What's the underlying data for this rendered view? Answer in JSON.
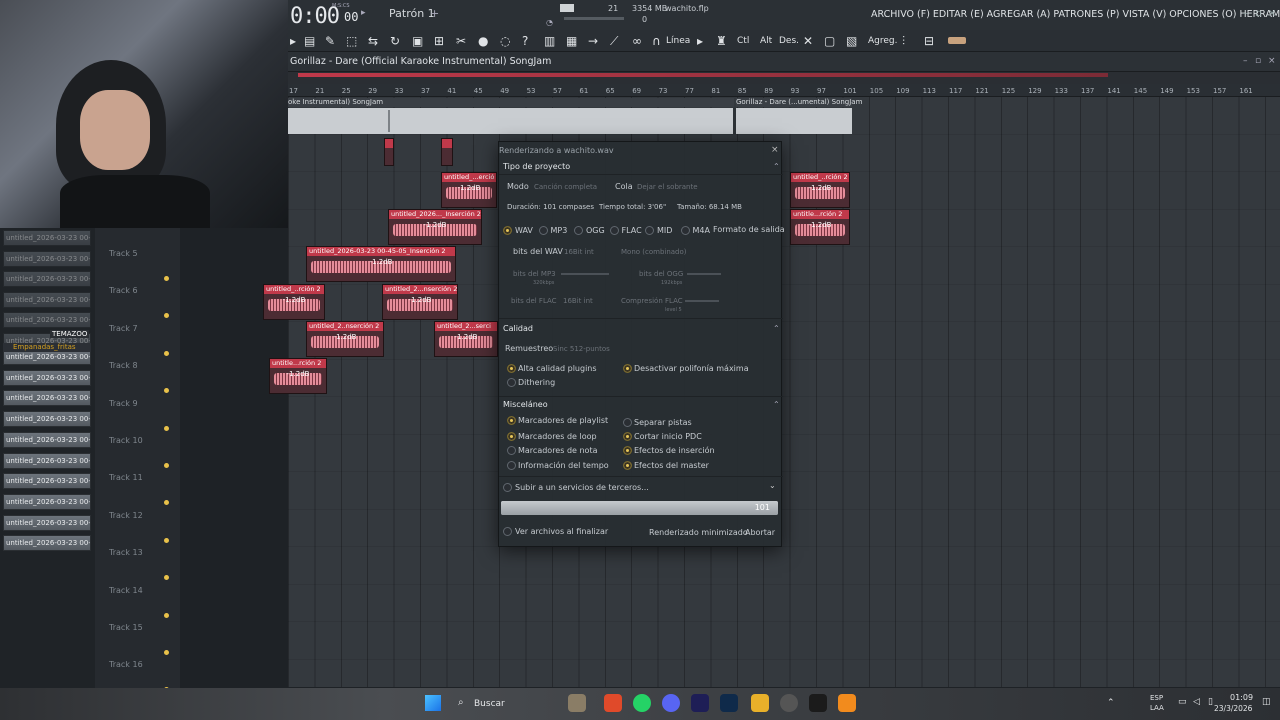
{
  "transport": {
    "time": "0:00",
    "time_sub": "00",
    "mcs": "M:S:CS",
    "pattern": "Patrón 1",
    "cpu": "21",
    "memory": "3354 MB",
    "voices": "0",
    "file": "wachito.flp"
  },
  "menu": "ARCHIVO (F) EDITAR (E) AGREGAR (A) PATRONES (P) VISTA (V) OPCIONES (O) HERRAMIENTAS (T) AYUDA",
  "toolbar": {
    "line": "Línea",
    "ctl": "Ctl",
    "alt": "Alt",
    "des": "Des.",
    "agreg": "Agreg."
  },
  "playlist": {
    "title": "Gorillaz - Dare (Official Karaoke Instrumental) SongJam",
    "ruler": [
      "17",
      "21",
      "25",
      "29",
      "33",
      "37",
      "41",
      "45",
      "49",
      "53",
      "57",
      "61",
      "65",
      "69",
      "73",
      "77",
      "81",
      "85",
      "89",
      "93",
      "97",
      "101",
      "105",
      "109",
      "113",
      "117",
      "121",
      "125",
      "129",
      "133",
      "137",
      "141",
      "145",
      "149",
      "153",
      "157",
      "161"
    ],
    "audio_left": "oke Instrumental) SongJam",
    "audio_right": "Gorillaz - Dare (...umental) SongJam",
    "tracks": [
      "Track 5",
      "Track 6",
      "Track 7",
      "Track 8",
      "Track 9",
      "Track 10",
      "Track 11",
      "Track 12",
      "Track 13",
      "Track 14",
      "Track 15",
      "Track 16"
    ],
    "clips": {
      "c1": "untitled_...erció",
      "c2": "untitled_2026..._Inserción 2",
      "c3": "untitled_2026-03-23 00-45-05_Inserción 2",
      "c4": "untitled_..rción 2",
      "c5": "untitled_2...nserción 2",
      "c6": "untitled_2..nserción 2",
      "c7": "untitled_2...serci",
      "c8": "untitle...rción 2",
      "c9": "untitled_..rción 2",
      "c10": "untitle...rción 2",
      "db": "-1.2dB"
    }
  },
  "left_panel": {
    "items": [
      "untitled_2026-03-23 00-",
      "untitled_2026-03-23 00-",
      "untitled_2026-03-23 00-",
      "untitled_2026-03-23 00-",
      "untitled_2026-03-23 00-",
      "untitled_2026-03-23 00-",
      "untitled_2026-03-23 00-",
      "untitled_2026-03-23 00-",
      "untitled_2026-03-23 00-",
      "untitled_2026-03-23 00-",
      "untitled_2026-03-23 00-",
      "untitled_2026-03-23 00-",
      "untitled_2026-03-23 00-",
      "untitled_2026-03-23 00-",
      "untitled_2026-03-23 00-",
      "untitled_2026-03-23 00-"
    ],
    "temazoo": "TEMAZOO",
    "empanadas": "Empanadas_fritas"
  },
  "dialog": {
    "title": "Renderizando a wachito.wav",
    "project_type": "Tipo de proyecto",
    "mode_label": "Modo",
    "mode_value": "Canción completa",
    "tail_label": "Cola",
    "tail_value": "Dejar el sobrante",
    "duration": "Duración: 101 compases",
    "total_time": "Tiempo total: 3'06\"",
    "size": "Tamaño: 68.14 MB",
    "formats": [
      "WAV",
      "MP3",
      "OGG",
      "FLAC",
      "MID",
      "M4A"
    ],
    "output_format": "Formato de salida",
    "wav_bits_label": "bits del WAV",
    "wav_bits_value": "16Bit int",
    "wav_mode": "Mono (combinado)",
    "mp3_bits": "bits del MP3",
    "mp3_value": "320kbps",
    "ogg_bits": "bits del OGG",
    "ogg_value": "192kbps",
    "flac_bits": "bits del FLAC",
    "flac_value": "16Bit int",
    "flac_comp": "Compresión FLAC",
    "flac_level": "level 5",
    "quality": "Calidad",
    "resample_label": "Remuestreo",
    "resample_value": "Sinc 512-puntos",
    "q_opts": [
      "Alta calidad plugins",
      "Desactivar polifonía máxima",
      "Dithering"
    ],
    "misc": "Misceláneo",
    "misc_opts": [
      "Marcadores de playlist",
      "Separar pistas",
      "Marcadores de loop",
      "Cortar inicio PDC",
      "Marcadores de nota",
      "Efectos de inserción",
      "Información del tempo",
      "Efectos del master"
    ],
    "upload": "Subir a un servicios de terceros...",
    "progress_value": "101",
    "progress_fraction": 1.0,
    "view_files": "Ver archivos al finalizar",
    "minimized": "Renderizado minimizado",
    "abort": "Abortar"
  },
  "taskbar": {
    "search": "Buscar",
    "lang1": "ESP",
    "lang2": "LAA",
    "time": "01:09",
    "date": "23/3/2026"
  }
}
